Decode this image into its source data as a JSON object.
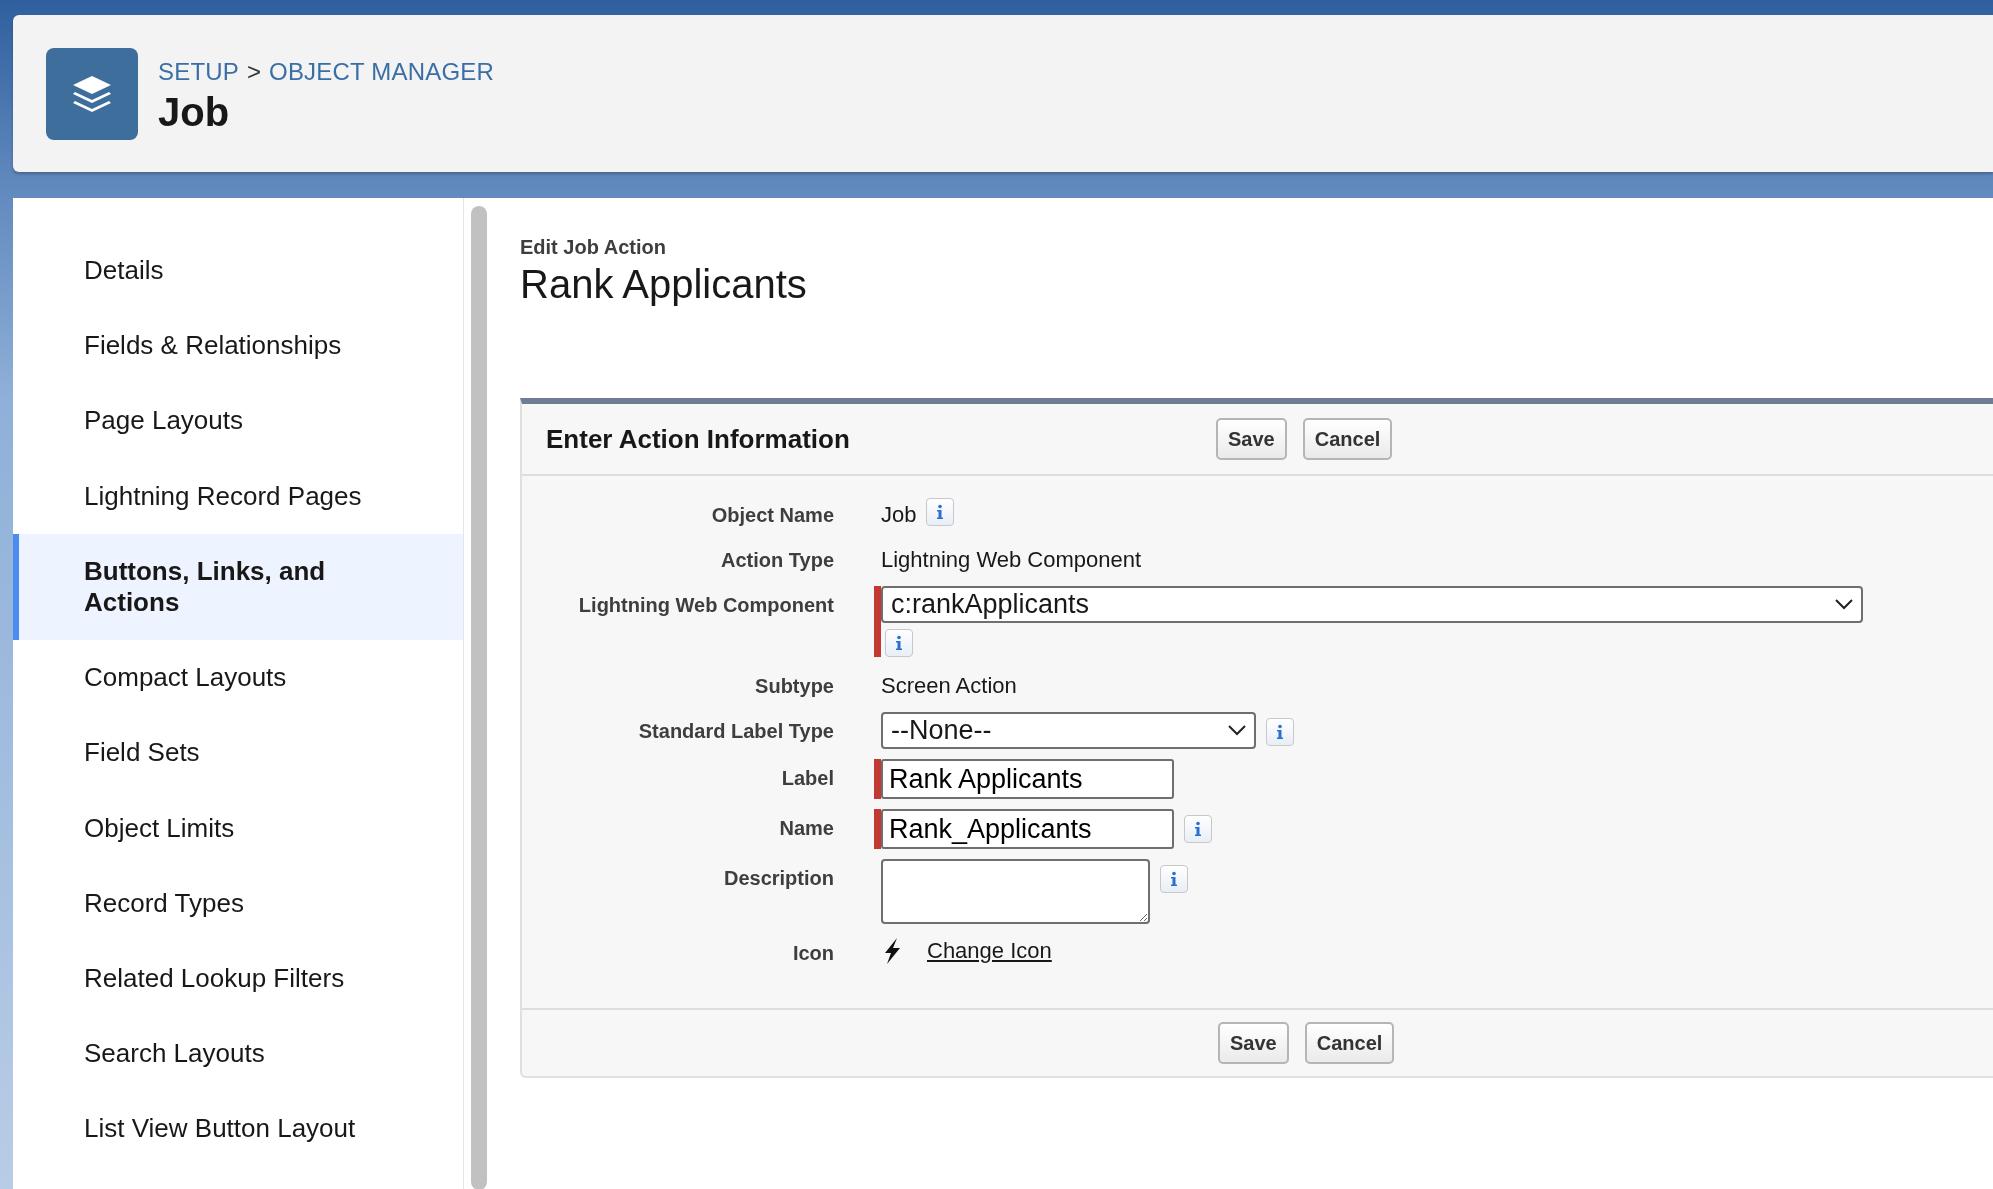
{
  "header": {
    "breadcrumb": [
      {
        "label": "SETUP"
      },
      {
        "label": "OBJECT MANAGER"
      }
    ],
    "separator": ">",
    "title": "Job"
  },
  "sidebar": {
    "items": [
      {
        "label": "Details",
        "selected": false
      },
      {
        "label": "Fields & Relationships",
        "selected": false
      },
      {
        "label": "Page Layouts",
        "selected": false
      },
      {
        "label": "Lightning Record Pages",
        "selected": false
      },
      {
        "label": "Buttons, Links, and Actions",
        "selected": true
      },
      {
        "label": "Compact Layouts",
        "selected": false
      },
      {
        "label": "Field Sets",
        "selected": false
      },
      {
        "label": "Object Limits",
        "selected": false
      },
      {
        "label": "Record Types",
        "selected": false
      },
      {
        "label": "Related Lookup Filters",
        "selected": false
      },
      {
        "label": "Search Layouts",
        "selected": false
      },
      {
        "label": "List View Button Layout",
        "selected": false
      }
    ]
  },
  "page": {
    "subtitle": "Edit Job Action",
    "title": "Rank Applicants"
  },
  "form": {
    "title": "Enter Action Information",
    "buttons": [
      "Save",
      "Cancel"
    ],
    "fields": [
      {
        "label": "Object Name",
        "kind": "text",
        "value": "Job",
        "required": false,
        "info": true
      },
      {
        "label": "Action Type",
        "kind": "text",
        "value": "Lightning Web Component",
        "required": false
      },
      {
        "label": "Lightning Web Component",
        "kind": "combobox",
        "value": "c:rankApplicants",
        "required": true,
        "info": true
      },
      {
        "label": "Subtype",
        "kind": "text",
        "value": "Screen Action",
        "required": false
      },
      {
        "label": "Standard Label Type",
        "kind": "select",
        "value": "--None--",
        "required": false,
        "info": true
      },
      {
        "label": "Label",
        "kind": "input",
        "value": "Rank Applicants",
        "required": true
      },
      {
        "label": "Name",
        "kind": "input",
        "value": "Rank_Applicants",
        "required": true,
        "info": true
      },
      {
        "label": "Description",
        "kind": "textarea",
        "required": false,
        "info": true
      },
      {
        "label": "Icon",
        "kind": "icon",
        "link": "Change Icon",
        "required": false
      }
    ],
    "footer_buttons": [
      "Save",
      "Cancel"
    ]
  }
}
